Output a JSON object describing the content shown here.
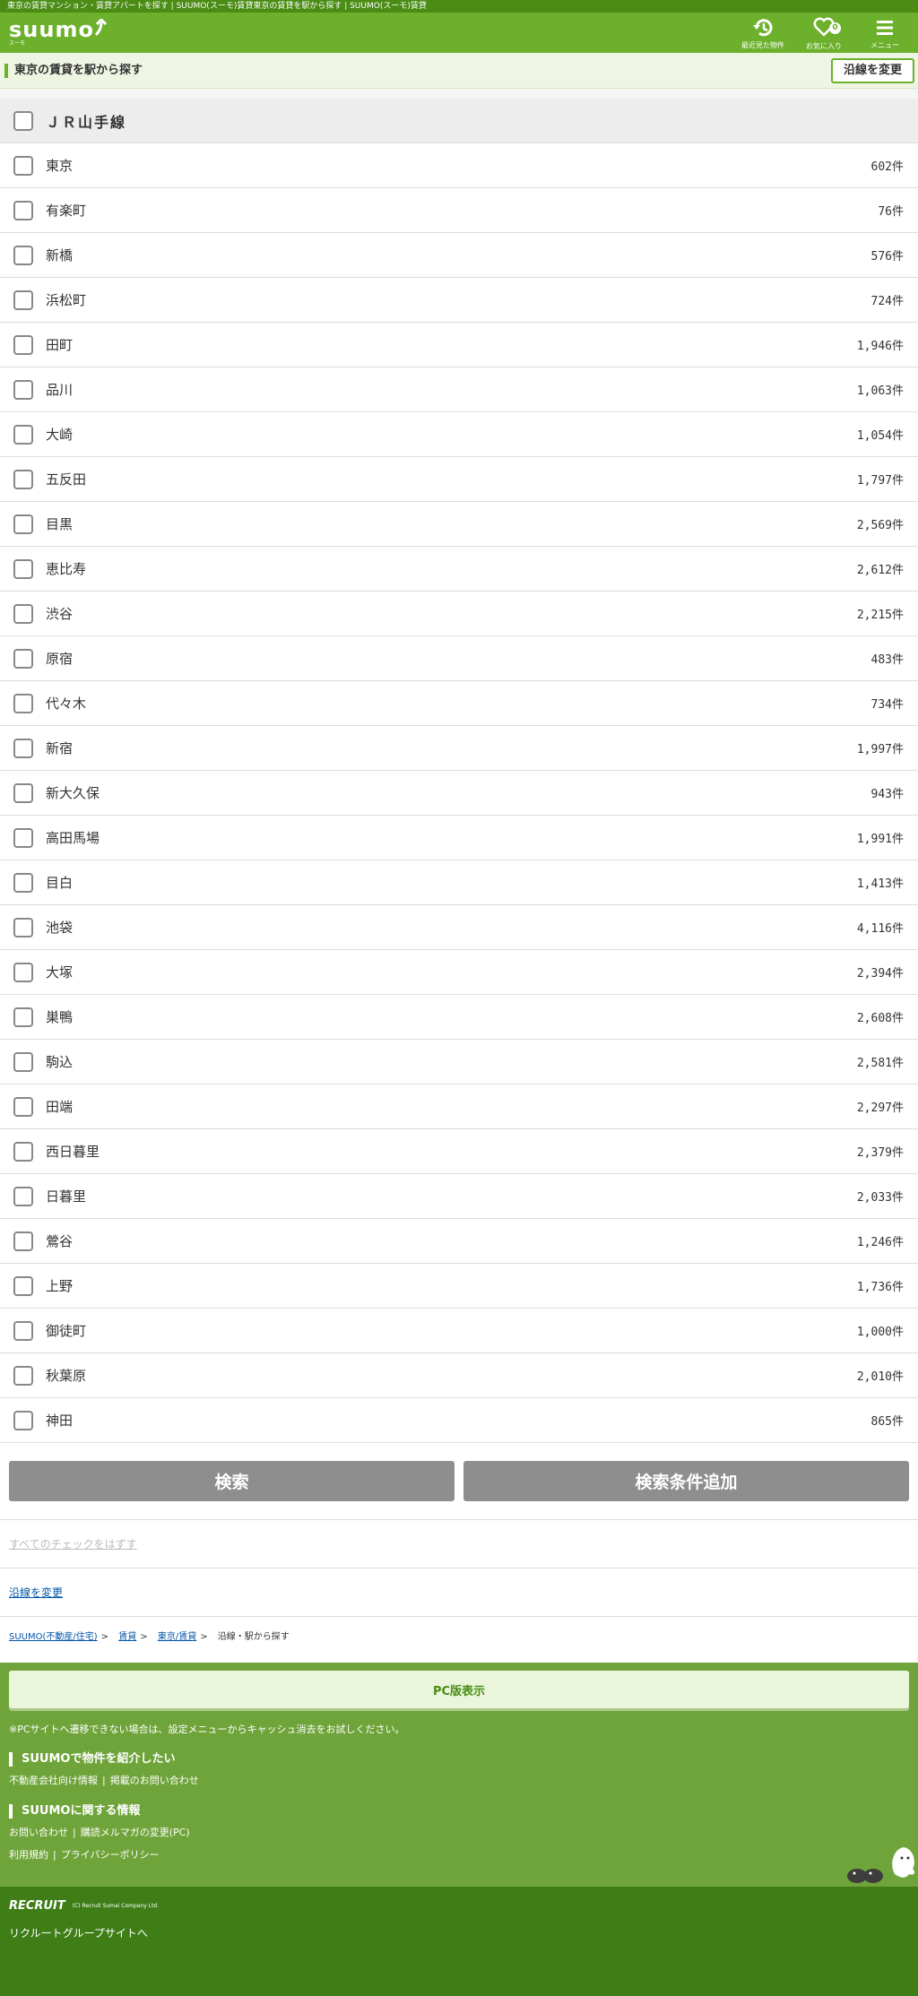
{
  "browser_title": "東京の賃貸マンション・賃貸アパートを探す | SUUMO(スーモ)賃貸東京の賃貸を駅から探す | SUUMO(スーモ)賃貸",
  "header": {
    "logo": "suumo",
    "logo_sub": "スーモ",
    "recent_label": "最近見た物件",
    "favorites_label": "お気に入り",
    "favorites_count": "0",
    "menu_label": "メニュー"
  },
  "subhead": {
    "title": "東京の賃貸を駅から探す",
    "change_line_button": "沿線を変更"
  },
  "line": {
    "name": "ＪＲ山手線"
  },
  "stations": [
    {
      "name": "東京",
      "count": "602件"
    },
    {
      "name": "有楽町",
      "count": "76件"
    },
    {
      "name": "新橋",
      "count": "576件"
    },
    {
      "name": "浜松町",
      "count": "724件"
    },
    {
      "name": "田町",
      "count": "1,946件"
    },
    {
      "name": "品川",
      "count": "1,063件"
    },
    {
      "name": "大崎",
      "count": "1,054件"
    },
    {
      "name": "五反田",
      "count": "1,797件"
    },
    {
      "name": "目黒",
      "count": "2,569件"
    },
    {
      "name": "恵比寿",
      "count": "2,612件"
    },
    {
      "name": "渋谷",
      "count": "2,215件"
    },
    {
      "name": "原宿",
      "count": "483件"
    },
    {
      "name": "代々木",
      "count": "734件"
    },
    {
      "name": "新宿",
      "count": "1,997件"
    },
    {
      "name": "新大久保",
      "count": "943件"
    },
    {
      "name": "高田馬場",
      "count": "1,991件"
    },
    {
      "name": "目白",
      "count": "1,413件"
    },
    {
      "name": "池袋",
      "count": "4,116件"
    },
    {
      "name": "大塚",
      "count": "2,394件"
    },
    {
      "name": "巣鴨",
      "count": "2,608件"
    },
    {
      "name": "駒込",
      "count": "2,581件"
    },
    {
      "name": "田端",
      "count": "2,297件"
    },
    {
      "name": "西日暮里",
      "count": "2,379件"
    },
    {
      "name": "日暮里",
      "count": "2,033件"
    },
    {
      "name": "鶯谷",
      "count": "1,246件"
    },
    {
      "name": "上野",
      "count": "1,736件"
    },
    {
      "name": "御徒町",
      "count": "1,000件"
    },
    {
      "name": "秋葉原",
      "count": "2,010件"
    },
    {
      "name": "神田",
      "count": "865件"
    }
  ],
  "actions": {
    "search_button": "検索",
    "add_conditions_button": "検索条件追加",
    "uncheck_all": "すべてのチェックをはずす",
    "change_line_link": "沿線を変更"
  },
  "breadcrumb": {
    "items": [
      "SUUMO(不動産/住宅)",
      "賃貸",
      "東京/賃貸"
    ],
    "current": "沿線・駅から探す",
    "separator": ">"
  },
  "footer": {
    "pc_button": "PC版表示",
    "note": "※PCサイトへ遷移できない場合は、設定メニューからキャッシュ消去をお試しください。",
    "section1_title": "SUUMOで物件を紹介したい",
    "section1_links": [
      "不動産会社向け情報",
      "掲載のお問い合わせ"
    ],
    "section2_title": "SUUMOに関する情報",
    "section2_links_row1": [
      "お問い合わせ",
      "購読メルマガの変更(PC)"
    ],
    "section2_links_row2": [
      "利用規約",
      "プライバシーポリシー"
    ],
    "link_separator": "|",
    "recruit_logo": "RECRUIT",
    "copyright": "(C) Recruit Sumai Company Ltd.",
    "group_link": "リクルートグループサイトへ"
  },
  "colors": {
    "brand_green": "#6cb02c",
    "dark_green": "#4a8c14",
    "footer_green": "#6fa43a",
    "footer_dark": "#3f7e17",
    "button_gray": "#8e8e8e"
  }
}
